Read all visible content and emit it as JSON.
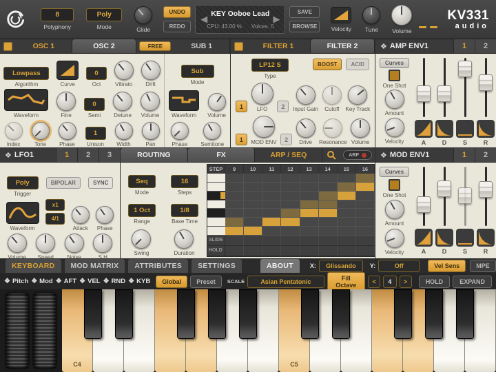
{
  "topbar": {
    "polyphony": {
      "value": "8",
      "label": "Polyphony"
    },
    "mode": {
      "value": "Poly",
      "label": "Mode"
    },
    "glide_label": "Glide",
    "undo": "UNDO",
    "redo": "REDO",
    "preset": {
      "name": "KEY Ooboe Lead",
      "cpu": "CPU: 43.00 %",
      "voices": "Voices: 0"
    },
    "save": "SAVE",
    "browse": "BROWSE",
    "velocity_label": "Velocity",
    "tune_label": "Tune",
    "volume_label": "Volume",
    "brand": {
      "line1": "KV331",
      "line2": "audio"
    }
  },
  "osc": {
    "tabs": {
      "osc1": "OSC 1",
      "osc2": "OSC 2",
      "free": "FREE",
      "sub1": "SUB 1"
    },
    "osc2": {
      "algorithm": {
        "value": "Lowpass",
        "label": "Algorithm"
      },
      "curve_label": "Curve",
      "oct": {
        "value": "0",
        "label": "Oct"
      },
      "vibrato_label": "Vibrato",
      "drift_label": "Drift",
      "waveform_label": "Waveform",
      "fine_label": "Fine",
      "semi": {
        "value": "0",
        "label": "Semi"
      },
      "detune_label": "Detune",
      "volume_label": "Volume",
      "index_label": "Index",
      "tone_label": "Tone",
      "phase_label": "Phase",
      "unison": {
        "value": "1",
        "label": "Unison"
      },
      "width_label": "Width",
      "pan_label": "Pan"
    },
    "sub1": {
      "mode": {
        "value": "Sub",
        "label": "Mode"
      },
      "waveform_label": "Waveform",
      "volume_label": "Volume",
      "phase_label": "Phase",
      "semitone_label": "Semitone"
    }
  },
  "filter": {
    "tabs": {
      "f1": "FILTER 1",
      "f2": "FILTER 2"
    },
    "type": {
      "value": "LP12 S",
      "label": "Type"
    },
    "boost": "BOOST",
    "acid": "ACID",
    "lfo": {
      "b1": "1",
      "b2": "2",
      "label": "LFO"
    },
    "input_gain": "Input Gain",
    "cutoff": "Cutoff",
    "key_track": "Key Track",
    "modenv": {
      "b1": "1",
      "b2": "2",
      "label": "MOD ENV"
    },
    "drive": "Drive",
    "resonance": "Resonance",
    "volume": "Volume"
  },
  "amp_env": {
    "title": "AMP ENV1",
    "tab1": "1",
    "tab2": "2",
    "curves": "Curves",
    "one_shot": "One Shot",
    "amount": "Amount",
    "velocity": "Velocity",
    "sliders": [
      {
        "label": "A",
        "value": 0.34,
        "disabled": false
      },
      {
        "label": "D",
        "value": 0.34,
        "disabled": false
      },
      {
        "label": "S",
        "value": 0.9,
        "disabled": false
      },
      {
        "label": "R",
        "value": 0.6,
        "disabled": false
      }
    ]
  },
  "mod_env": {
    "title": "MOD ENV1",
    "tab1": "1",
    "tab2": "2",
    "curves": "Curves",
    "one_shot": "One Shot",
    "amount": "Amount",
    "velocity": "Velocity",
    "sliders": [
      {
        "label": "A",
        "value": 0.3,
        "disabled": false
      },
      {
        "label": "D",
        "value": 0.66,
        "disabled": false
      },
      {
        "label": "S",
        "value": 0.5,
        "disabled": true
      },
      {
        "label": "R",
        "value": 0.64,
        "disabled": false
      }
    ]
  },
  "lfo1": {
    "title": "LFO1",
    "tab1": "1",
    "tab2": "2",
    "tab3": "3",
    "trigger": {
      "value": "Poly",
      "label": "Trigger"
    },
    "bipolar": "BIPOLAR",
    "sync": "SYNC",
    "waveform_label": "Waveform",
    "mult": "x1",
    "ratio": "4/1",
    "attack_label": "Attack",
    "phase_label": "Phase",
    "volume_label": "Volume",
    "speed_label": "Speed",
    "noise_label": "Noise",
    "sh_label": "S H"
  },
  "arp": {
    "tabs": {
      "routing": "ROUTING",
      "fx": "FX",
      "arpseq": "ARP / SEQ"
    },
    "arp_button": "ARP",
    "mode": {
      "value": "Seq",
      "label": "Mode"
    },
    "steps": {
      "value": "16",
      "label": "Steps"
    },
    "range": {
      "value": "1 Oct",
      "label": "Range"
    },
    "base_time": {
      "value": "1/8",
      "label": "Base Time"
    },
    "swing_label": "Swing",
    "duration_label": "Duration",
    "grid": {
      "header": "STEP",
      "columns": [
        "9",
        "10",
        "11",
        "12",
        "13",
        "14",
        "15",
        "16"
      ],
      "slide_label": "SLIDE",
      "hold_label": "HOLD",
      "piano_rows": [
        "w",
        "w",
        "ba",
        "w",
        "b",
        "w",
        "w"
      ],
      "cells": [
        {
          "on": 7,
          "ghost": [
            6
          ]
        },
        {
          "on": 7,
          "ghost": []
        },
        {
          "on": 6,
          "ghost": []
        },
        {
          "on": 6,
          "ghost": [
            5
          ]
        },
        {
          "on": 5,
          "ghost": [
            4
          ]
        },
        {
          "on": 5,
          "ghost": [
            3,
            4
          ]
        },
        {
          "on": 3,
          "ghost": [
            2
          ]
        },
        {
          "on": 2,
          "ghost": [
            1
          ]
        }
      ]
    }
  },
  "bottom_tabs": {
    "keyboard": "KEYBOARD",
    "mod_matrix": "MOD MATRIX",
    "attributes": "ATTRIBUTES",
    "settings": "SETTINGS",
    "about": "ABOUT",
    "x_label": "X:",
    "x_value": "Glissando",
    "y_label": "Y:",
    "y_value": "Off",
    "vel_sens": "Vel Sens",
    "mpe": "MPE"
  },
  "kb_options": {
    "toggles": [
      "Pitch",
      "Mod",
      "AFT",
      "VEL",
      "RND",
      "KYB"
    ],
    "global": "Global",
    "preset": "Preset",
    "scale_label": "SCALE",
    "scale_value": "Asian Pentatonic",
    "fill_octave": "Fill Octave",
    "octave": "4",
    "prev": "<",
    "next": ">",
    "hold": "HOLD",
    "expand": "EXPAND"
  },
  "keyboard": {
    "white_keys": [
      {
        "note": "C4",
        "label": "C4",
        "hl": true
      },
      {
        "note": "D4",
        "label": "",
        "hl": false
      },
      {
        "note": "E4",
        "label": "",
        "hl": false
      },
      {
        "note": "F4",
        "label": "",
        "hl": true
      },
      {
        "note": "G4",
        "label": "",
        "hl": true
      },
      {
        "note": "A4",
        "label": "",
        "hl": false
      },
      {
        "note": "B4",
        "label": "",
        "hl": false
      },
      {
        "note": "C5",
        "label": "C5",
        "hl": true
      },
      {
        "note": "D5",
        "label": "",
        "hl": false
      },
      {
        "note": "E5",
        "label": "",
        "hl": false
      },
      {
        "note": "F5",
        "label": "",
        "hl": true
      },
      {
        "note": "G5",
        "label": "",
        "hl": true
      },
      {
        "note": "A5",
        "label": "",
        "hl": false
      },
      {
        "note": "B5",
        "label": "",
        "hl": false
      }
    ],
    "black_after": [
      0,
      1,
      3,
      4,
      5,
      7,
      8,
      10,
      11,
      12
    ]
  },
  "colors": {
    "accent": "#dca23a",
    "panel": "#e9e6da",
    "dark": "#3a3a3a",
    "record_red": "#b23a2e"
  }
}
